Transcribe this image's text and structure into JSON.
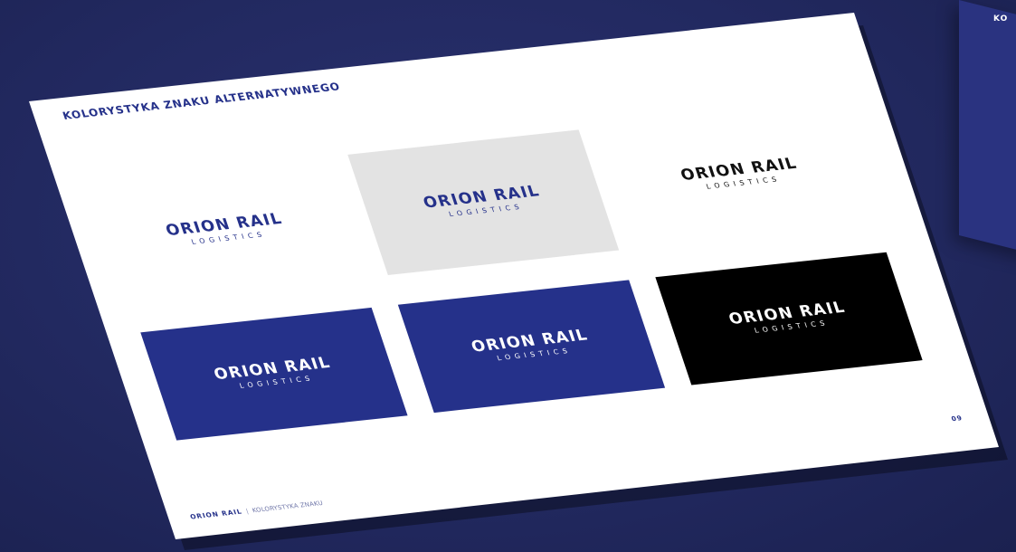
{
  "side_page": {
    "label": "KO"
  },
  "slide": {
    "heading": "KOLORYSTYKA ZNAKU ALTERNATYWNEGO",
    "page_number": "09",
    "footer": {
      "brand": "ORION RAIL",
      "separator": "|",
      "section": "KOLORYSTYKA ZNAKU"
    },
    "logo_variants": [
      {
        "name": "ORION RAIL",
        "sub": "LOGISTICS",
        "background": "#ffffff",
        "text_color": "#25318a"
      },
      {
        "name": "ORION RAIL",
        "sub": "LOGISTICS",
        "background": "#e3e3e3",
        "text_color": "#25318a"
      },
      {
        "name": "ORION RAIL",
        "sub": "LOGISTICS",
        "background": "#ffffff",
        "text_color": "#111111"
      },
      {
        "name": "ORION RAIL",
        "sub": "LOGISTICS",
        "background": "#25318a",
        "text_color": "#ffffff"
      },
      {
        "name": "ORION RAIL",
        "sub": "LOGISTICS",
        "background": "#25318a",
        "text_color": "#ffffff"
      },
      {
        "name": "ORION RAIL",
        "sub": "LOGISTICS",
        "background": "#000000",
        "text_color": "#ffffff"
      }
    ]
  }
}
